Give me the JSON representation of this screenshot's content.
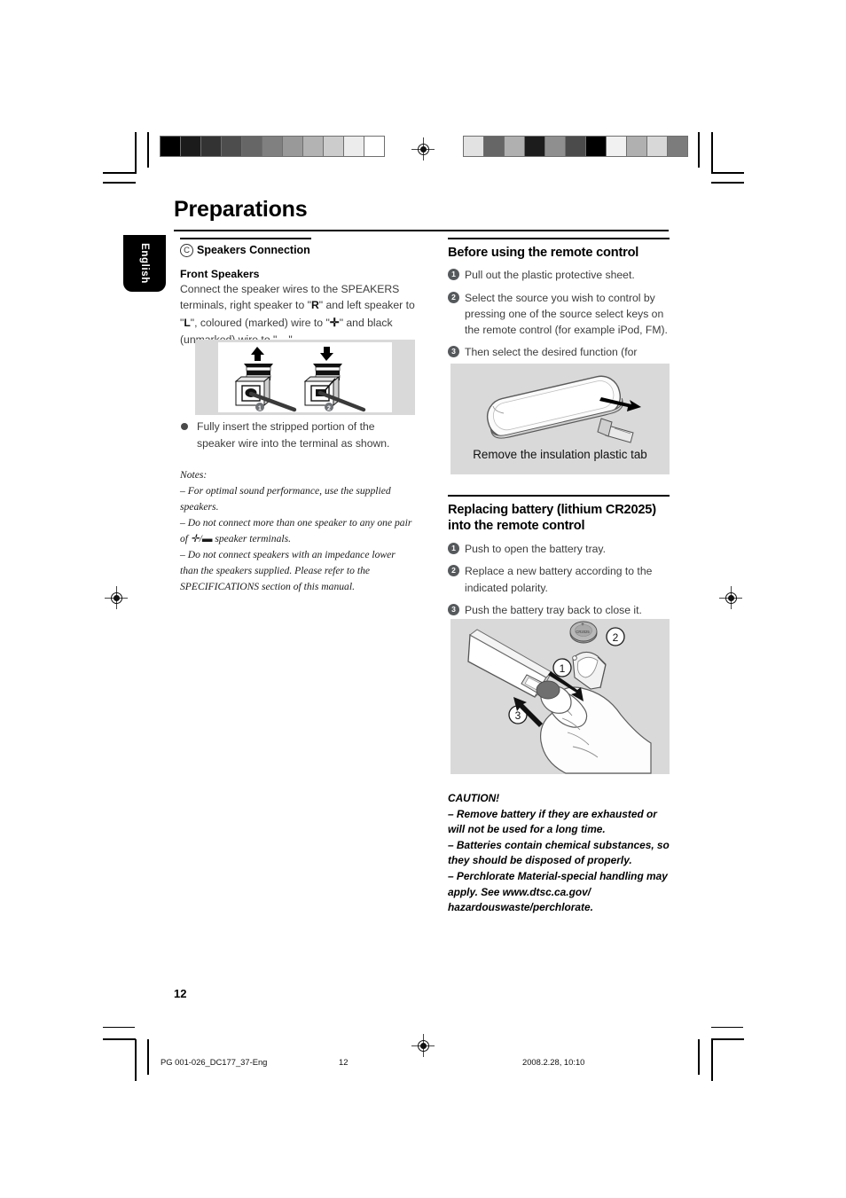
{
  "document": {
    "page_title": "Preparations",
    "language_tab": "English",
    "folio": "12"
  },
  "calibration": {
    "left_bar": [
      "#000000",
      "#1b1b1b",
      "#333333",
      "#4d4d4d",
      "#666666",
      "#808080",
      "#999999",
      "#b3b3b3",
      "#cccccc",
      "#ececec",
      "#ffffff"
    ],
    "right_bar": [
      "#e2e2e2",
      "#666666",
      "#b0b0b0",
      "#1c1c1c",
      "#8f8f8f",
      "#4b4b4b",
      "#000000",
      "#f1f1f1",
      "#b0b0b0",
      "#d8d8d8",
      "#7c7c7c"
    ]
  },
  "left_column": {
    "section_marker": "C",
    "section_title": "Speakers Connection",
    "sub_title": "Front Speakers",
    "paragraph_1": "Connect the speaker wires to the SPEAKERS terminals, right speaker to \"",
    "paragraph_r": "R",
    "paragraph_2": "\" and left speaker to \"",
    "paragraph_l": "L",
    "paragraph_3": "\", coloured (marked) wire to \"",
    "paragraph_plus": "✛",
    "paragraph_4": "\" and black (unmarked) wire to \"",
    "paragraph_minus": "▬",
    "paragraph_5": "\".",
    "figure": {
      "name": "speaker-terminal-diagram",
      "step_1": "1",
      "step_2": "2"
    },
    "bullet": "Fully insert the stripped portion of the speaker wire into the terminal as shown.",
    "notes_label": "Notes:",
    "notes": [
      "–  For optimal sound performance, use the supplied speakers.",
      "–  Do not connect more than one speaker to any one pair of ✛/▬ speaker terminals.",
      "–  Do not connect speakers with an impedance lower than the speakers supplied.  Please refer to the SPECIFICATIONS section of this manual."
    ]
  },
  "right_column": {
    "section_1": {
      "title": "Before using the remote control",
      "steps": [
        {
          "num": "1",
          "text": "Pull out the plastic protective sheet."
        },
        {
          "num": "2",
          "text": "Select the source you wish to control by pressing one of the source select keys on the remote control (for example iPod, FM)."
        },
        {
          "num": "3",
          "text": "Then select the desired function (for example ▶, ◀◀, ▶▶)."
        }
      ],
      "figure": {
        "name": "remote-insulation-tab-diagram",
        "caption": "Remove the insulation plastic tab"
      }
    },
    "section_2": {
      "title": "Replacing battery (lithium CR2025) into the remote control",
      "steps": [
        {
          "num": "1",
          "text": "Push to open the battery tray."
        },
        {
          "num": "2",
          "text": "Replace a new battery according to the indicated polarity."
        },
        {
          "num": "3",
          "text": "Push the battery tray back to close it."
        }
      ],
      "figure": {
        "name": "battery-replacement-diagram",
        "callout_1": "1",
        "callout_2": "2",
        "callout_3": "3",
        "battery_label": "CR2025",
        "battery_polarity": "+"
      }
    },
    "caution": {
      "label": "CAUTION!",
      "lines": [
        "–  Remove battery if they are exhausted or will not be used for a long time.",
        "–  Batteries contain chemical substances, so they should be disposed of properly.",
        "–   Perchlorate Material-special handling may apply. See www.dtsc.ca.gov/ hazardouswaste/perchlorate."
      ]
    }
  },
  "footer": {
    "file": "PG 001-026_DC177_37-Eng",
    "page": "12",
    "timestamp": "2008.2.28, 10:10"
  }
}
